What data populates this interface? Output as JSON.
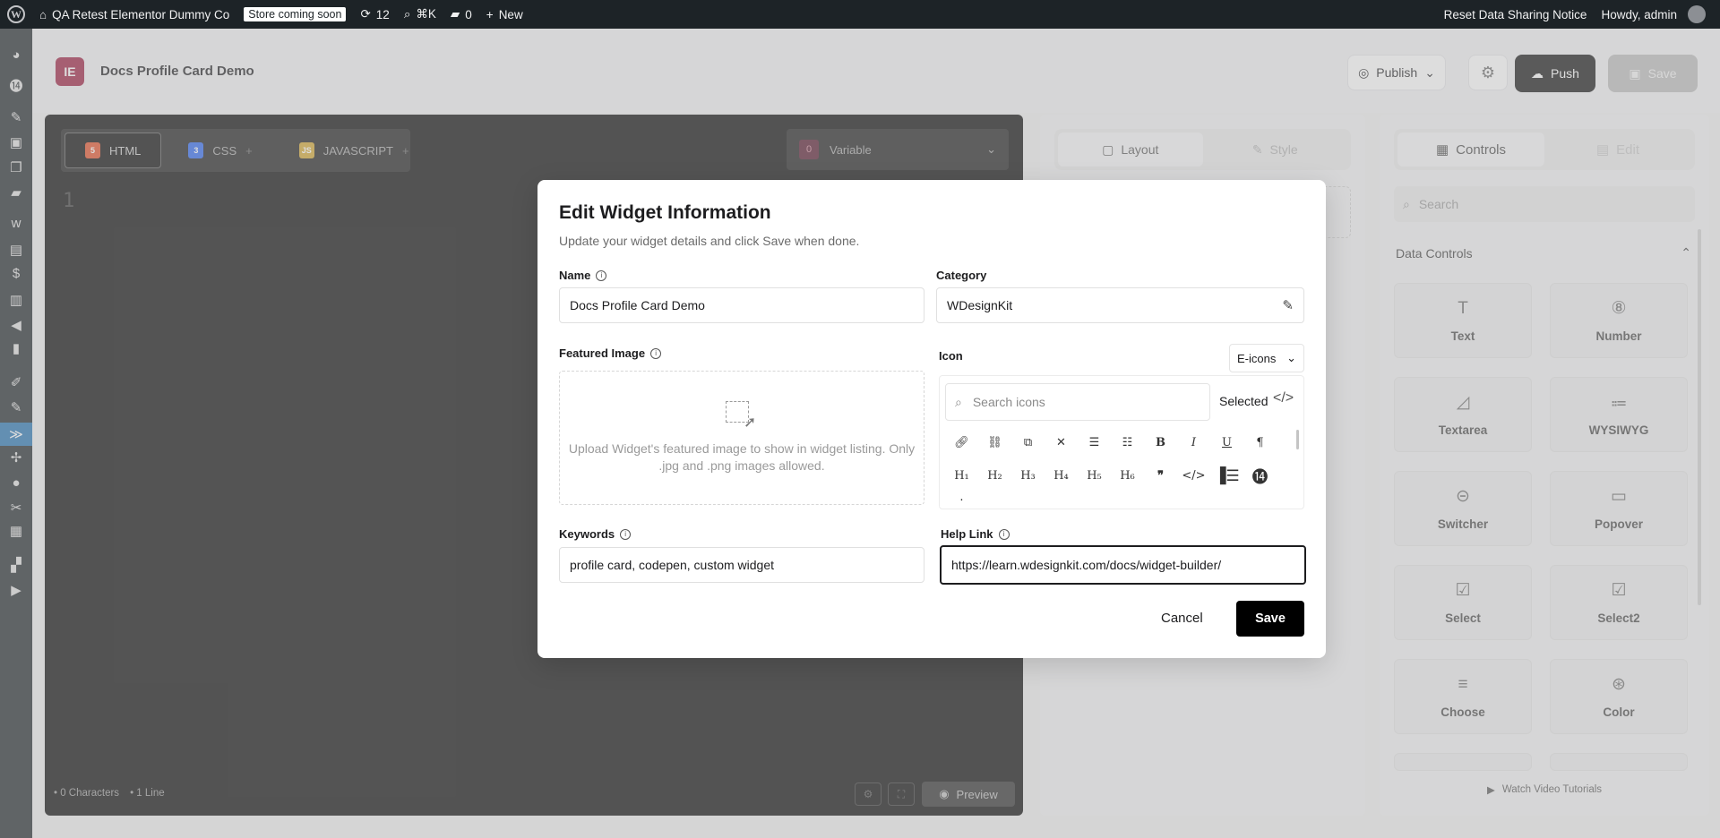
{
  "admin_bar": {
    "site_name": "QA Retest Elementor Dummy Co",
    "store_badge": "Store coming soon",
    "updates_count": "12",
    "search_shortcut": "⌘K",
    "comments_count": "0",
    "new_label": "New",
    "reset_notice": "Reset Data Sharing Notice",
    "howdy": "Howdy, admin"
  },
  "editor": {
    "title": "Docs Profile Card Demo",
    "publish_label": "Publish",
    "push_label": "Push",
    "save_label": "Save"
  },
  "code_panel": {
    "tabs": [
      {
        "label": "HTML",
        "icon": "html5-icon",
        "color": "#e44d26"
      },
      {
        "label": "CSS",
        "icon": "css3-icon",
        "color": "#2965f1"
      },
      {
        "label": "JAVASCRIPT",
        "icon": "js-icon",
        "color": "#d4a72c"
      }
    ],
    "variable_count": "0",
    "variable_label": "Variable",
    "line_number": "1",
    "characters": "• 0 Characters",
    "lines": "• 1 Line",
    "preview_label": "Preview"
  },
  "middle_panel": {
    "tabs": [
      "Layout",
      "Style"
    ]
  },
  "controls_panel": {
    "tabs": [
      "Controls",
      "Edit"
    ],
    "search_placeholder": "Search",
    "section_title": "Data Controls",
    "cards": [
      {
        "label": "Text",
        "icon": "text-icon"
      },
      {
        "label": "Number",
        "icon": "number-icon"
      },
      {
        "label": "Textarea",
        "icon": "textarea-icon"
      },
      {
        "label": "WYSIWYG",
        "icon": "wysiwyg-icon"
      },
      {
        "label": "Switcher",
        "icon": "switcher-icon"
      },
      {
        "label": "Popover",
        "icon": "popover-icon"
      },
      {
        "label": "Select",
        "icon": "select-icon"
      },
      {
        "label": "Select2",
        "icon": "select2-icon"
      },
      {
        "label": "Choose",
        "icon": "choose-icon"
      },
      {
        "label": "Color",
        "icon": "color-icon"
      }
    ],
    "watch_label": "Watch Video Tutorials"
  },
  "modal": {
    "title": "Edit Widget Information",
    "subtitle": "Update your widget details and click Save when done.",
    "name_label": "Name",
    "name_value": "Docs Profile Card Demo",
    "category_label": "Category",
    "category_value": "WDesignKit",
    "featured_label": "Featured Image",
    "upload_text": "Upload Widget's featured image to show in widget listing. Only .jpg and .png images allowed.",
    "icon_label": "Icon",
    "icon_library": "E-icons",
    "icon_search_placeholder": "Search icons",
    "selected_label": "Selected",
    "keywords_label": "Keywords",
    "keywords_value": "profile card, codepen, custom widget",
    "help_label": "Help Link",
    "help_value": "https://learn.wdesignkit.com/docs/widget-builder/",
    "cancel_label": "Cancel",
    "save_label": "Save"
  }
}
